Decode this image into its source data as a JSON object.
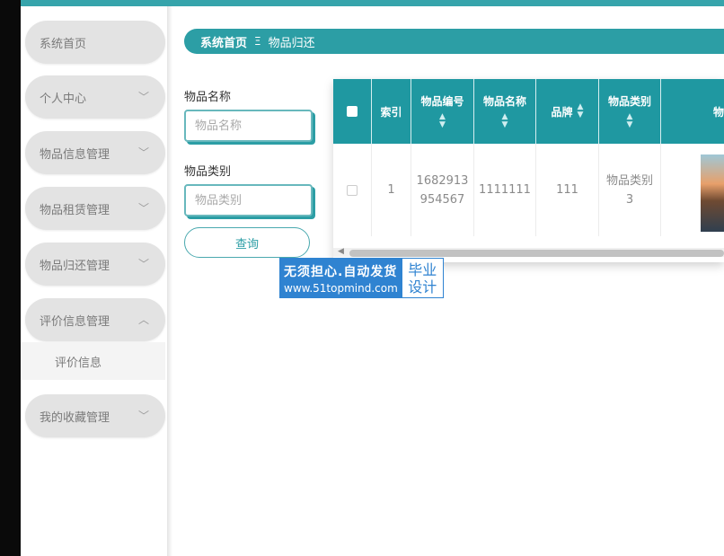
{
  "sidebar": {
    "items": [
      {
        "label": "系统首页",
        "chevron": ""
      },
      {
        "label": "个人中心",
        "chevron": "﹀"
      },
      {
        "label": "物品信息管理",
        "chevron": "﹀"
      },
      {
        "label": "物品租赁管理",
        "chevron": "﹀"
      },
      {
        "label": "物品归还管理",
        "chevron": "﹀"
      },
      {
        "label": "评价信息管理",
        "chevron": "︿"
      },
      {
        "label": "我的收藏管理",
        "chevron": "﹀"
      }
    ],
    "submenu": {
      "label": "评价信息"
    }
  },
  "breadcrumb": {
    "home": "系统首页",
    "separator": "Ξ",
    "current": "物品归还"
  },
  "search": {
    "name_label": "物品名称",
    "name_placeholder": "物品名称",
    "category_label": "物品类别",
    "category_placeholder": "物品类别",
    "button_label": "查询"
  },
  "table": {
    "headers": [
      "索引",
      "物品编号",
      "物品名称",
      "品牌",
      "物品类别",
      "物品"
    ],
    "rows": [
      {
        "index": "1",
        "item_no_line1": "1682913",
        "item_no_line2": "954567",
        "name": "1111111",
        "brand": "111",
        "category_line1": "物品类别",
        "category_line2": "3"
      }
    ]
  },
  "watermark": {
    "line1": "无须担心.自动发货",
    "line2": "www.51topmind.com",
    "right_top": "毕业",
    "right_bottom": "设计"
  },
  "colors": {
    "accent": "#2c9ea5",
    "table_header": "#1f98a1",
    "sidebar_pill": "#e3e3e3",
    "watermark": "#2f83d1"
  }
}
